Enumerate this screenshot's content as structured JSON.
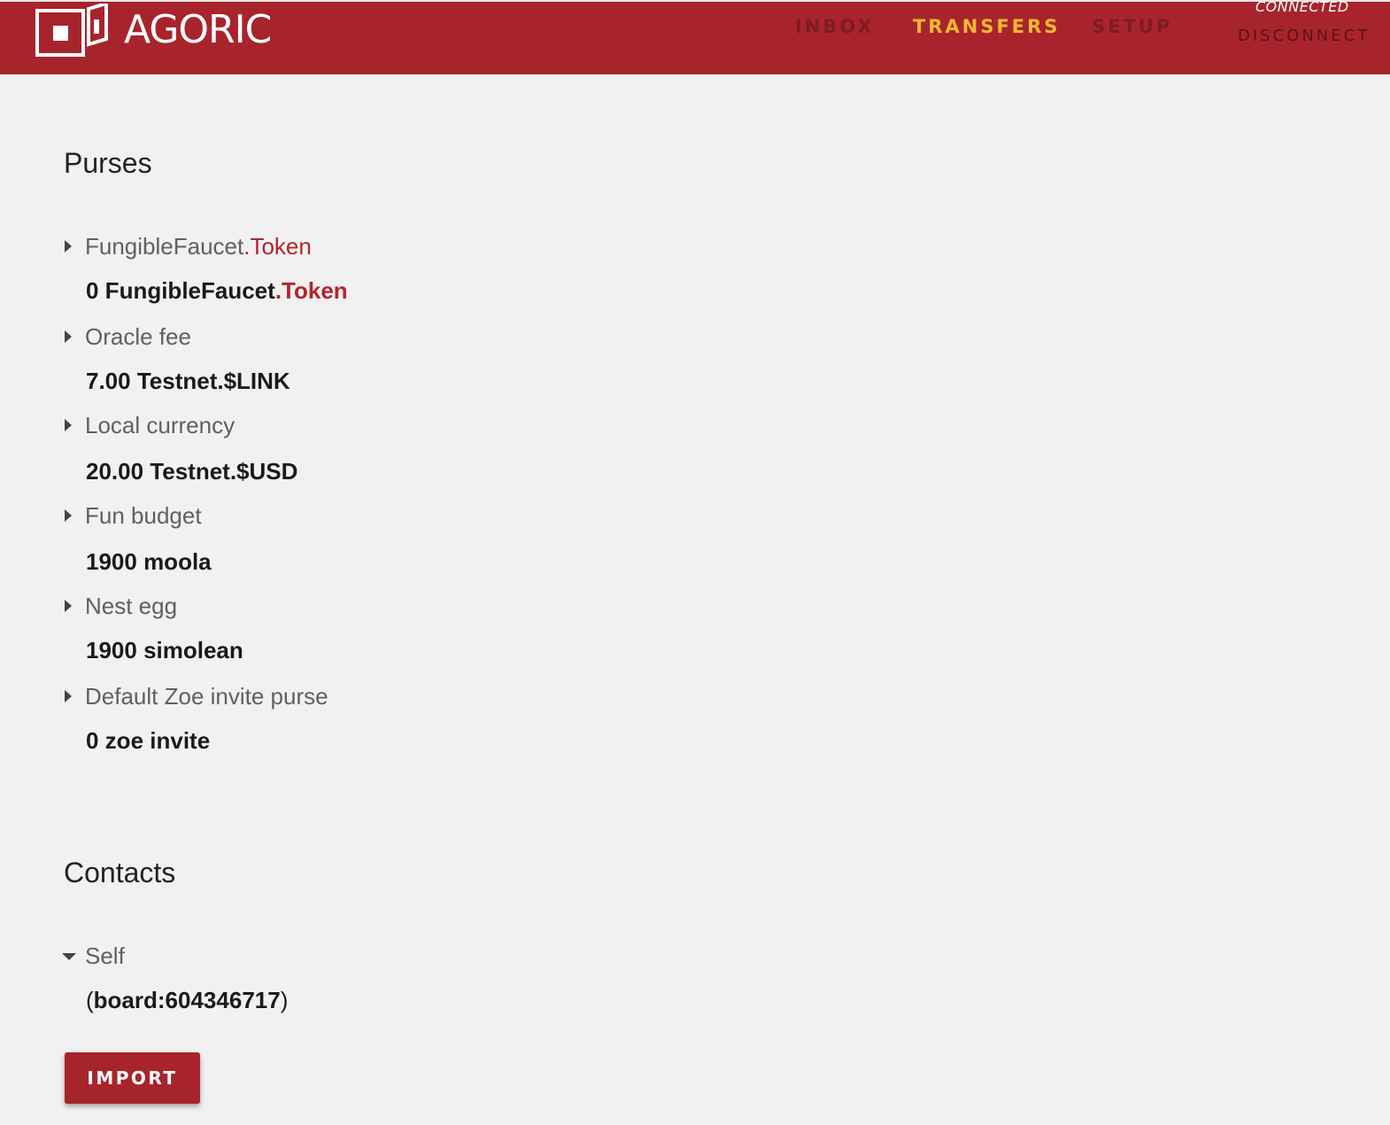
{
  "brand": {
    "name": "AGORIC",
    "color": "#a8242c",
    "accent": "#b3242c",
    "active_nav_color": "#f5b82e",
    "logo_icon": "agoric-logo-icon"
  },
  "nav": {
    "items": [
      {
        "label": "INBOX",
        "active": false
      },
      {
        "label": "TRANSFERS",
        "active": true
      },
      {
        "label": "SETUP",
        "active": false
      }
    ],
    "status": "CONNECTED",
    "disconnect_label": "DISCONNECT"
  },
  "purses": {
    "title": "Purses",
    "items": [
      {
        "label_main": "FungibleFaucet",
        "label_accent": ".Token",
        "value_main": "0 FungibleFaucet",
        "value_accent": ".Token",
        "expanded": false
      },
      {
        "label": "Oracle fee",
        "value": "7.00 Testnet.$LINK",
        "expanded": false
      },
      {
        "label": "Local currency",
        "value": "20.00 Testnet.$USD",
        "expanded": false
      },
      {
        "label": "Fun budget",
        "value": "1900 moola",
        "expanded": false
      },
      {
        "label": "Nest egg",
        "value": "1900 simolean",
        "expanded": false
      },
      {
        "label": "Default Zoe invite purse",
        "value": "0 zoe invite",
        "expanded": false
      }
    ]
  },
  "contacts": {
    "title": "Contacts",
    "items": [
      {
        "label": "Self",
        "value_open": "(",
        "value": "board:604346717",
        "value_close": ")",
        "expanded": true
      }
    ]
  },
  "import_label": "IMPORT"
}
